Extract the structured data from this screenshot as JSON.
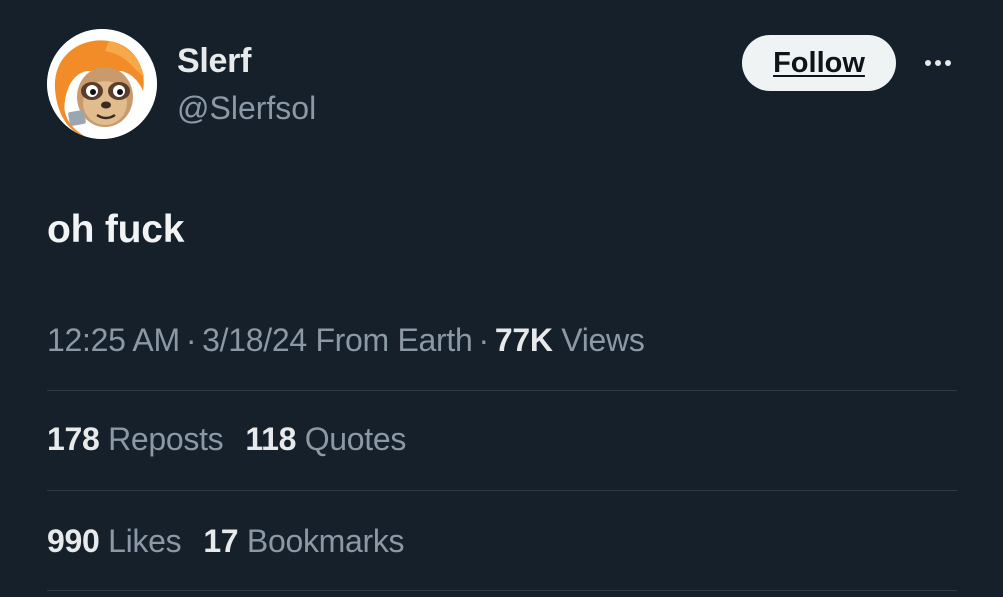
{
  "user": {
    "display_name": "Slerf",
    "handle": "@Slerfsol",
    "avatar_icon": "sloth-avatar"
  },
  "actions": {
    "follow_label": "Follow",
    "more_icon": "more-options-icon"
  },
  "tweet": {
    "text": "oh fuck"
  },
  "meta": {
    "time": "12:25 AM",
    "separator": "·",
    "date": "3/18/24",
    "location": "From Earth",
    "views_count": "77K",
    "views_label": "Views"
  },
  "stats_row1": {
    "reposts_count": "178",
    "reposts_label": "Reposts",
    "quotes_count": "118",
    "quotes_label": "Quotes"
  },
  "stats_row2": {
    "likes_count": "990",
    "likes_label": "Likes",
    "bookmarks_count": "17",
    "bookmarks_label": "Bookmarks"
  },
  "colors": {
    "background": "#15202b",
    "primary_text": "#e7e9ea",
    "secondary_text": "#8b98a5",
    "button_bg": "#eff3f4",
    "avatar_accent": "#f28c28"
  }
}
